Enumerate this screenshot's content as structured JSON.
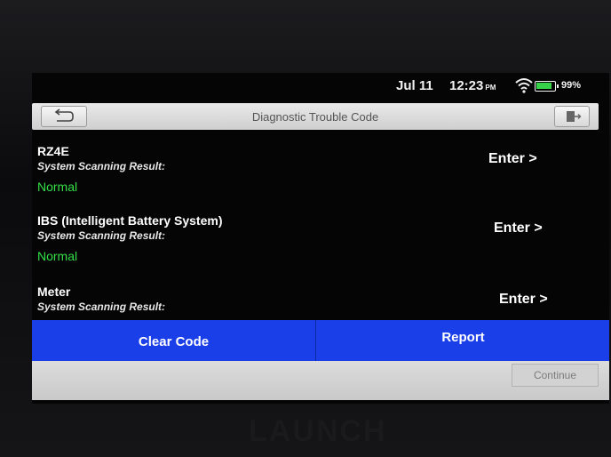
{
  "status_bar": {
    "date": "Jul 11",
    "time": "12:23",
    "ampm": "PM",
    "battery": "99%",
    "wifi_icon": "wifi-icon",
    "battery_icon": "battery-icon",
    "battery_color": "#36d24a"
  },
  "header": {
    "title": "Diagnostic Trouble Code",
    "back_icon": "back-arrow-icon",
    "exit_icon": "exit-icon"
  },
  "modules": [
    {
      "name": "RZ4E",
      "subtitle": "System Scanning Result:",
      "status": "Normal",
      "action": "Enter >"
    },
    {
      "name": "IBS (Intelligent Battery System)",
      "subtitle": "System Scanning Result:",
      "status": "Normal",
      "action": "Enter >"
    },
    {
      "name": "Meter",
      "subtitle": "System Scanning Result:",
      "status": "",
      "action": "Enter >"
    }
  ],
  "actions": {
    "clear_code": "Clear Code",
    "report": "Report",
    "continue": "Continue",
    "accent_color": "#1a3ee8",
    "normal_color": "#33e046"
  },
  "device": {
    "brand": "LAUNCH"
  }
}
